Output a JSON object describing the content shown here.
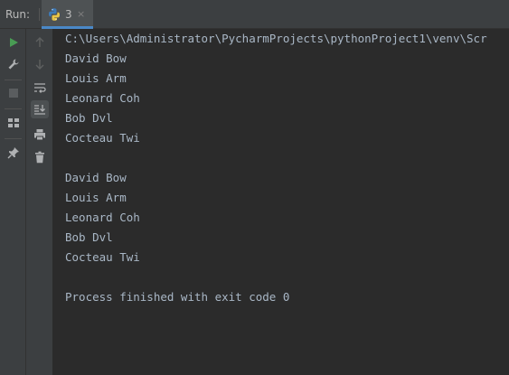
{
  "run_window": {
    "title": "Run:",
    "tab": {
      "label": "3",
      "close_glyph": "×",
      "icon": "python-icon"
    }
  },
  "toolbar": {
    "left_column": [
      "rerun-icon",
      "wrench-icon",
      "stop-icon",
      "layout-icon",
      "pin-icon"
    ],
    "right_column": [
      "arrow-up-icon",
      "arrow-down-icon",
      "soft-wrap-icon",
      "scroll-to-end-icon",
      "print-icon",
      "trash-icon"
    ]
  },
  "console": {
    "command": "C:\\Users\\Administrator\\PycharmProjects\\pythonProject1\\venv\\Scr",
    "output_block_1": [
      "David Bow",
      "Louis Arm",
      "Leonard Coh",
      "Bob Dvl",
      "Cocteau Twi"
    ],
    "output_block_2": [
      "David Bow",
      "Louis Arm",
      "Leonard Coh",
      "Bob Dvl",
      "Cocteau Twi"
    ],
    "exit_message": "Process finished with exit code 0"
  },
  "colors": {
    "background": "#2b2b2b",
    "panel": "#3c3f41",
    "text": "#a9b7c6",
    "run_green": "#499c54",
    "tab_underline": "#4a88c7"
  }
}
